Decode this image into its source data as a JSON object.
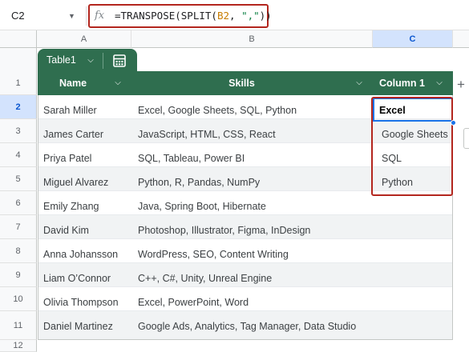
{
  "formula_bar": {
    "cell_ref": "C2",
    "fx_label": "fx",
    "formula_prefix": "=TRANSPOSE(SPLIT(",
    "formula_ref": "B2",
    "formula_sep": ", ",
    "formula_str": "\",\"",
    "formula_suffix": "))"
  },
  "columns": [
    "A",
    "B",
    "C"
  ],
  "table": {
    "name": "Table1",
    "headers": [
      "Name",
      "Skills",
      "Column 1"
    ],
    "header_color": "#2f6e4f",
    "rows": [
      {
        "name": "Sarah Miller",
        "skills": "Excel, Google Sheets, SQL, Python",
        "col1": "Excel"
      },
      {
        "name": "James Carter",
        "skills": "JavaScript, HTML, CSS, React",
        "col1": "Google Sheets"
      },
      {
        "name": "Priya Patel",
        "skills": "SQL, Tableau, Power BI",
        "col1": "SQL"
      },
      {
        "name": "Miguel Alvarez",
        "skills": "Python, R, Pandas, NumPy",
        "col1": "Python"
      },
      {
        "name": "Emily Zhang",
        "skills": "Java, Spring Boot, Hibernate",
        "col1": ""
      },
      {
        "name": "David Kim",
        "skills": "Photoshop, Illustrator, Figma, InDesign",
        "col1": ""
      },
      {
        "name": "Anna Johansson",
        "skills": "WordPress, SEO, Content Writing",
        "col1": ""
      },
      {
        "name": "Liam O’Connor",
        "skills": "C++, C#, Unity, Unreal Engine",
        "col1": ""
      },
      {
        "name": "Olivia Thompson",
        "skills": "Excel, PowerPoint, Word",
        "col1": ""
      },
      {
        "name": "Daniel Martinez",
        "skills": "Google Ads, Analytics, Tag Manager, Data Studio",
        "col1": ""
      }
    ]
  },
  "row_numbers": [
    "1",
    "2",
    "3",
    "4",
    "5",
    "6",
    "7",
    "8",
    "9",
    "10",
    "11",
    "12"
  ],
  "add_column_label": "+",
  "accent_color": "#1a73e8",
  "highlight_color": "#b3261e"
}
